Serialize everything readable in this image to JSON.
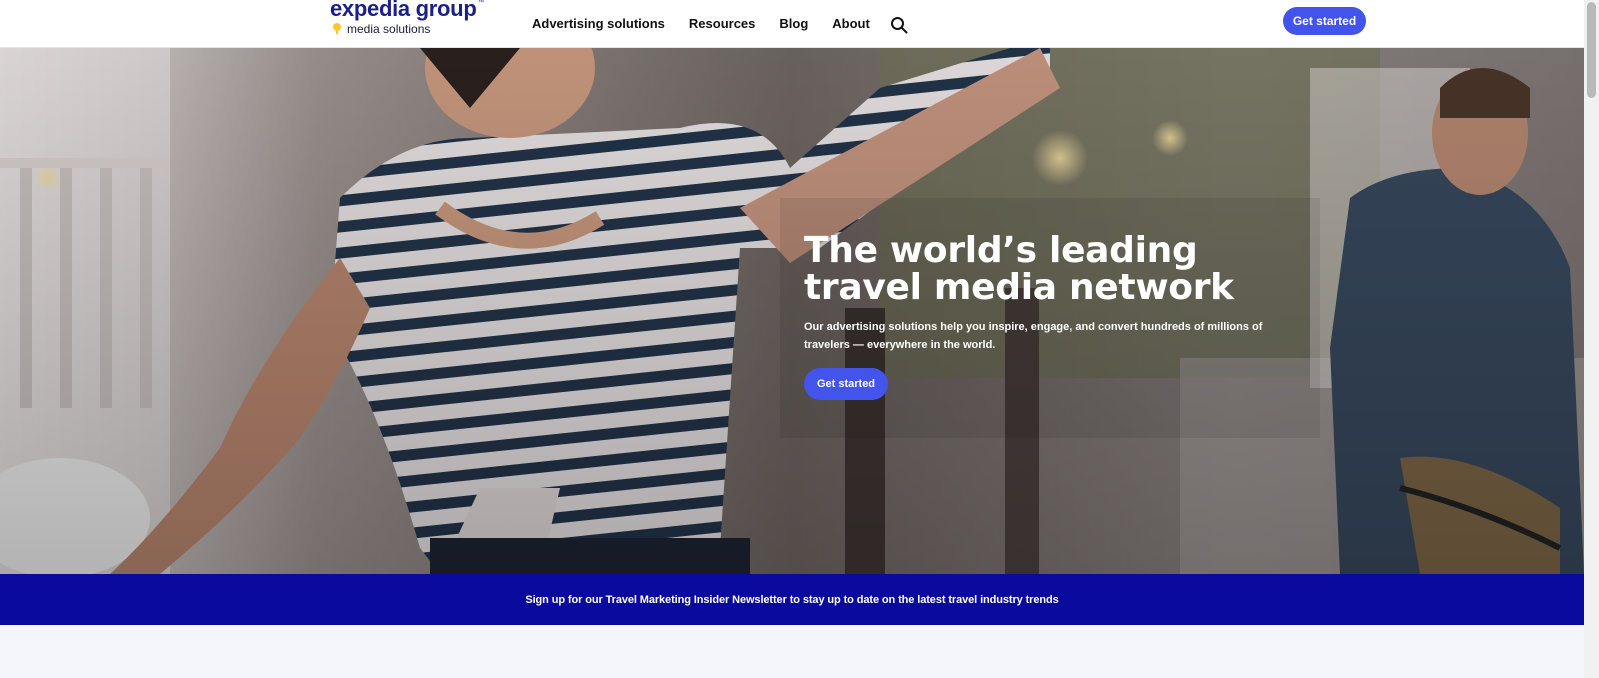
{
  "brand": {
    "name": "expedia group",
    "trademark": "™",
    "tagline": "media solutions"
  },
  "nav": {
    "items": [
      {
        "label": "Advertising solutions"
      },
      {
        "label": "Resources"
      },
      {
        "label": "Blog"
      },
      {
        "label": "About"
      }
    ],
    "search_icon": "search-icon",
    "cta_label": "Get started"
  },
  "hero": {
    "title": "The world’s leading travel media network",
    "description": "Our advertising solutions help you inspire, engage, and convert hundreds of millions of travelers — everywhere in the world.",
    "cta_label": "Get started"
  },
  "newsletter": {
    "text": "Sign up for our Travel Marketing Insider Newsletter to stay up to date on the latest travel industry trends"
  },
  "colors": {
    "brand_blue": "#1a1f8a",
    "button_blue": "#4354ec",
    "banner_navy": "#0a0a9f",
    "logo_yellow": "#ffc72c"
  }
}
